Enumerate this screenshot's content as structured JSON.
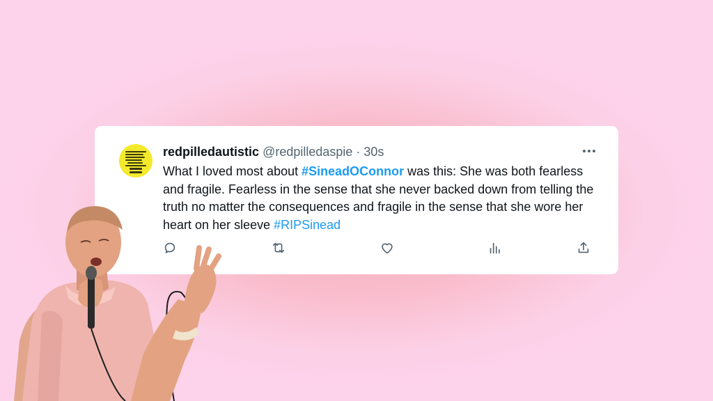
{
  "tweet": {
    "display_name": "redpilledautistic",
    "handle": "@redpilledaspie",
    "separator": " · ",
    "time": "30s",
    "text_parts": {
      "p1": "What I loved most about ",
      "hashtag1": "#SineadOConnor",
      "p2": " was this: She was both fearless and fragile. Fearless in the sense that she never backed down from telling the truth no matter the consequences and fragile in the sense that she wore her heart on her sleeve ",
      "hashtag2": "#RIPSinead"
    },
    "icons": {
      "avatar": "yellow-sticker-avatar",
      "more": "more-dots-icon",
      "reply": "reply-icon",
      "retweet": "retweet-icon",
      "like": "heart-icon",
      "views": "views-chart-icon",
      "share": "share-icon"
    }
  },
  "colors": {
    "link": "#1d9bf0",
    "text": "#0f1419",
    "muted": "#536471",
    "background_center": "#f6a8b8",
    "background_edge": "#fdd3ec"
  }
}
